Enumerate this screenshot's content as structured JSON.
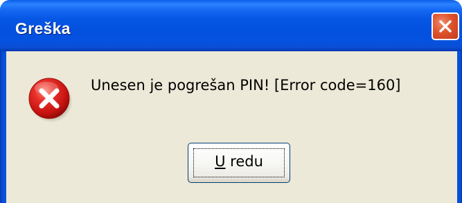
{
  "window": {
    "title": "Greška"
  },
  "icons": {
    "close": "close-icon",
    "error": "error-icon"
  },
  "dialog": {
    "message": "Unesen je pogrešan PIN! [Error code=160]",
    "ok_button": {
      "mnemonic": "U",
      "label_rest": " redu"
    }
  },
  "colors": {
    "titlebar": "#0552e1",
    "client_background": "#ece9d8",
    "close_button": "#e0532c",
    "error_icon": "#d51a16"
  }
}
